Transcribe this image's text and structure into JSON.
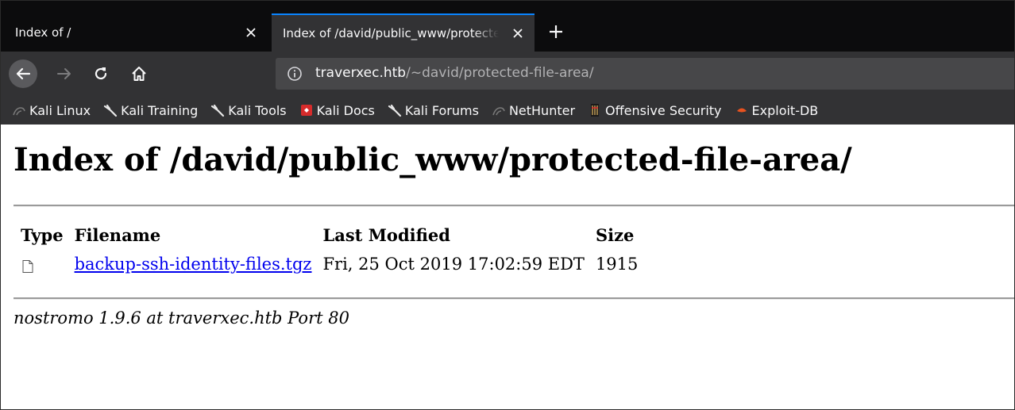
{
  "browser": {
    "tabs": [
      {
        "label": "Index of /",
        "active": false
      },
      {
        "label": "Index of /david/public_www/protected-file-area/",
        "active": true
      }
    ],
    "url": {
      "host": "traverxec.htb",
      "path": "/~david/protected-file-area/"
    },
    "bookmarks": [
      {
        "label": "Kali Linux",
        "icon": "kali-dragon-icon"
      },
      {
        "label": "Kali Training",
        "icon": "kali-dragon-icon"
      },
      {
        "label": "Kali Tools",
        "icon": "kali-dragon-icon"
      },
      {
        "label": "Kali Docs",
        "icon": "kali-docs-icon"
      },
      {
        "label": "Kali Forums",
        "icon": "kali-dragon-icon"
      },
      {
        "label": "NetHunter",
        "icon": "nethunter-icon"
      },
      {
        "label": "Offensive Security",
        "icon": "offsec-icon"
      },
      {
        "label": "Exploit-DB",
        "icon": "exploitdb-icon"
      }
    ],
    "colors": {
      "tabstrip": "#0c0c0d",
      "toolbar": "#323234",
      "urlbar": "#474749",
      "active_tab_accent": "#0a84ff",
      "link": "#0000ee"
    }
  },
  "page": {
    "title": "Index of /david/public_www/protected-file-area/",
    "columns": {
      "type": "Type",
      "filename": "Filename",
      "modified": "Last Modified",
      "size": "Size"
    },
    "files": [
      {
        "icon": "file-icon",
        "name": "backup-ssh-identity-files.tgz",
        "modified": "Fri, 25 Oct 2019 17:02:59 EDT",
        "size": "1915"
      }
    ],
    "footer": "nostromo 1.9.6 at traverxec.htb Port 80"
  }
}
